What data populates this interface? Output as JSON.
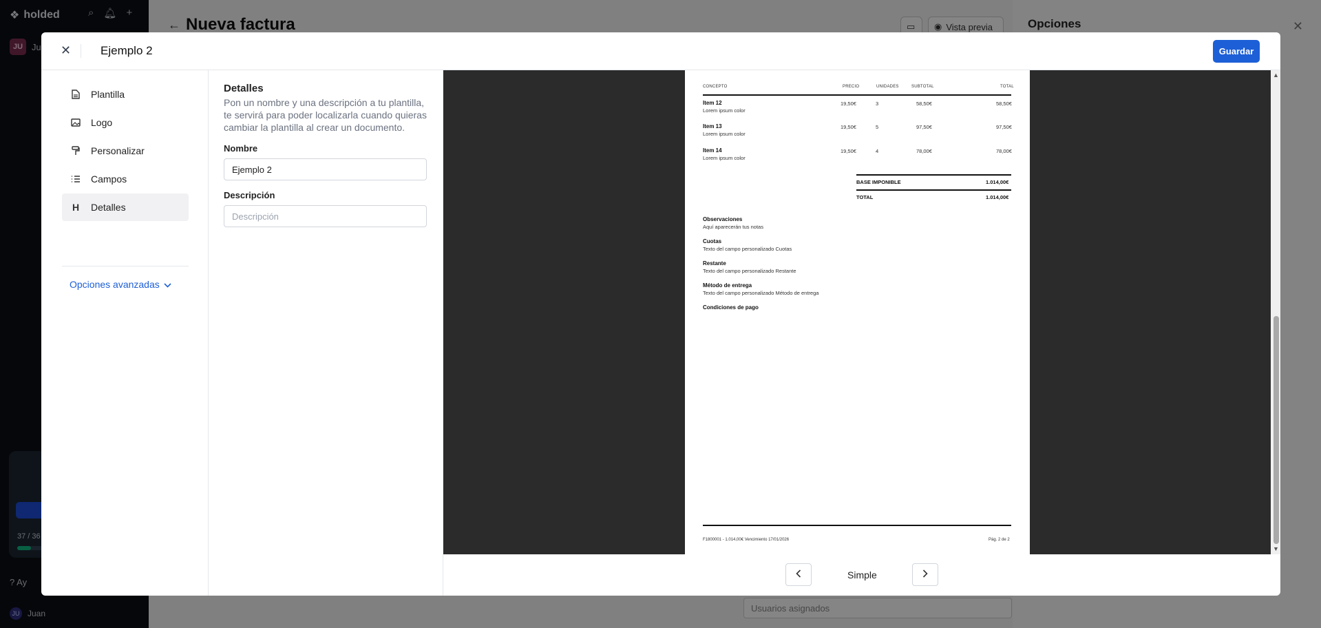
{
  "background": {
    "brand": "holded",
    "user_initials": "JU",
    "user_name_partial": "Jua",
    "page_title": "Nueva factura",
    "preview_button": "Vista previa",
    "options_title": "Opciones",
    "promo_count": "37 / 36",
    "help_partial": "Ay",
    "footer_initials": "JU",
    "footer_user": "Juan",
    "users_placeholder": "Usuarios asignados"
  },
  "modal": {
    "title": "Ejemplo 2",
    "save_label": "Guardar",
    "nav": {
      "items": [
        {
          "label": "Plantilla",
          "icon": "file-icon"
        },
        {
          "label": "Logo",
          "icon": "image-icon"
        },
        {
          "label": "Personalizar",
          "icon": "paint-roller-icon"
        },
        {
          "label": "Campos",
          "icon": "list-icon"
        },
        {
          "label": "Detalles",
          "icon": "heading-icon",
          "active": true
        }
      ],
      "advanced_label": "Opciones avanzadas"
    },
    "details": {
      "heading": "Detalles",
      "description": "Pon un nombre y una descripción a tu plantilla, te servirá para poder localizarla cuando quieras cambiar la plantilla al crear un documento.",
      "name_label": "Nombre",
      "name_value": "Ejemplo 2",
      "description_label": "Descripción",
      "description_placeholder": "Descripción"
    },
    "preview": {
      "template_name": "Simple",
      "table_headers": {
        "concept": "CONCEPTO",
        "price": "PRECIO",
        "units": "UNIDADES",
        "subtotal": "SUBTOTAL",
        "total": "TOTAL"
      },
      "items": [
        {
          "name": "Item 12",
          "desc": "Lorem ipsum color",
          "price": "19,50€",
          "units": "3",
          "subtotal": "58,50€",
          "total": "58,50€"
        },
        {
          "name": "Item 13",
          "desc": "Lorem ipsum color",
          "price": "19,50€",
          "units": "5",
          "subtotal": "97,50€",
          "total": "97,50€"
        },
        {
          "name": "Item 14",
          "desc": "Lorem ipsum color",
          "price": "19,50€",
          "units": "4",
          "subtotal": "78,00€",
          "total": "78,00€"
        }
      ],
      "base_label": "BASE IMPONIBLE",
      "base_value": "1.014,00€",
      "total_label": "TOTAL",
      "total_value": "1.014,00€",
      "blocks": [
        {
          "title": "Observaciones",
          "value": "Aquí aparecerán tus notas"
        },
        {
          "title": "Cuotas",
          "value": "Texto del campo personalizado Cuotas"
        },
        {
          "title": "Restante",
          "value": "Texto del campo personalizado Restante"
        },
        {
          "title": "Método de entrega",
          "value": "Texto del campo personalizado Método de entrega"
        },
        {
          "title": "Condiciones de pago",
          "value": ""
        }
      ],
      "footer_left": "F1800001 - 1.014,00€ Vencimiento 17/01/2026",
      "footer_right": "Pág. 2 de 2"
    }
  }
}
